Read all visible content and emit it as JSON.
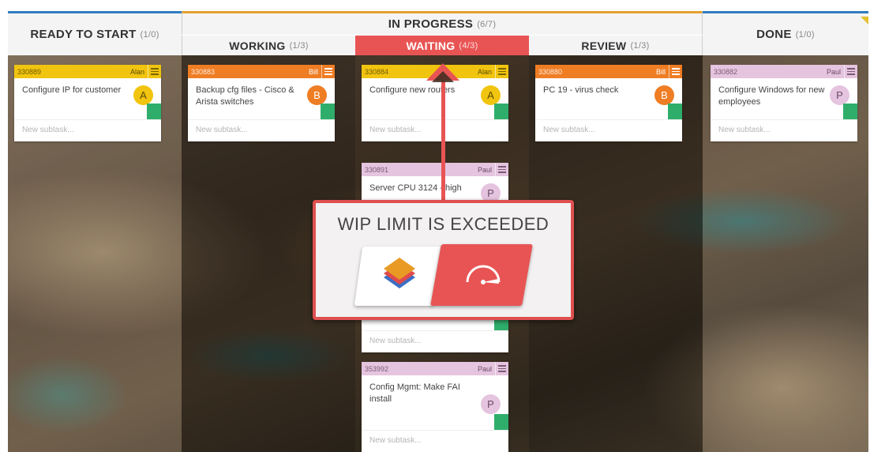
{
  "columns": {
    "ready": {
      "title": "READY TO START",
      "count": "(1/0)"
    },
    "in_progress": {
      "title": "IN PROGRESS",
      "count": "(6/7)"
    },
    "working": {
      "title": "WORKING",
      "count": "(1/3)"
    },
    "waiting": {
      "title": "WAITING",
      "count": "(4/3)"
    },
    "review": {
      "title": "REVIEW",
      "count": "(1/3)"
    },
    "done": {
      "title": "DONE",
      "count": "(1/0)"
    }
  },
  "cards": {
    "c330889": {
      "id": "330889",
      "owner": "Alan",
      "title": "Configure IP for customer",
      "avatar": "A",
      "subtask_placeholder": "New subtask..."
    },
    "c330883": {
      "id": "330883",
      "owner": "Bill",
      "title": "Backup cfg files - Cisco & Arista switches",
      "avatar": "B",
      "subtask_placeholder": "New subtask..."
    },
    "c330884": {
      "id": "330884",
      "owner": "Alan",
      "title": "Configure new routers",
      "avatar": "A",
      "subtask_placeholder": "New subtask..."
    },
    "c330891": {
      "id": "330891",
      "owner": "Paul",
      "title": "Server CPU 3124 - high",
      "avatar": "P",
      "subtask_placeholder": "New subtask..."
    },
    "c353992": {
      "id": "353992",
      "owner": "Paul",
      "title": "Config Mgmt: Make FAI install",
      "avatar": "P",
      "subtask_placeholder": "New subtask..."
    },
    "c330880": {
      "id": "330880",
      "owner": "Bill",
      "title": "PC 19 - virus check",
      "avatar": "B",
      "subtask_placeholder": "New subtask..."
    },
    "c330882": {
      "id": "330882",
      "owner": "Paul",
      "title": "Configure Windows for new employees",
      "avatar": "P",
      "subtask_placeholder": "New subtask..."
    }
  },
  "wip_dialog": {
    "message": "WIP LIMIT IS EXCEEDED"
  },
  "colors": {
    "accent_red": "#e85454",
    "yellow": "#f1c40f",
    "orange": "#ef7d23",
    "pink": "#e5c4df",
    "green": "#2fae6b",
    "blue": "#2f7dc1"
  }
}
